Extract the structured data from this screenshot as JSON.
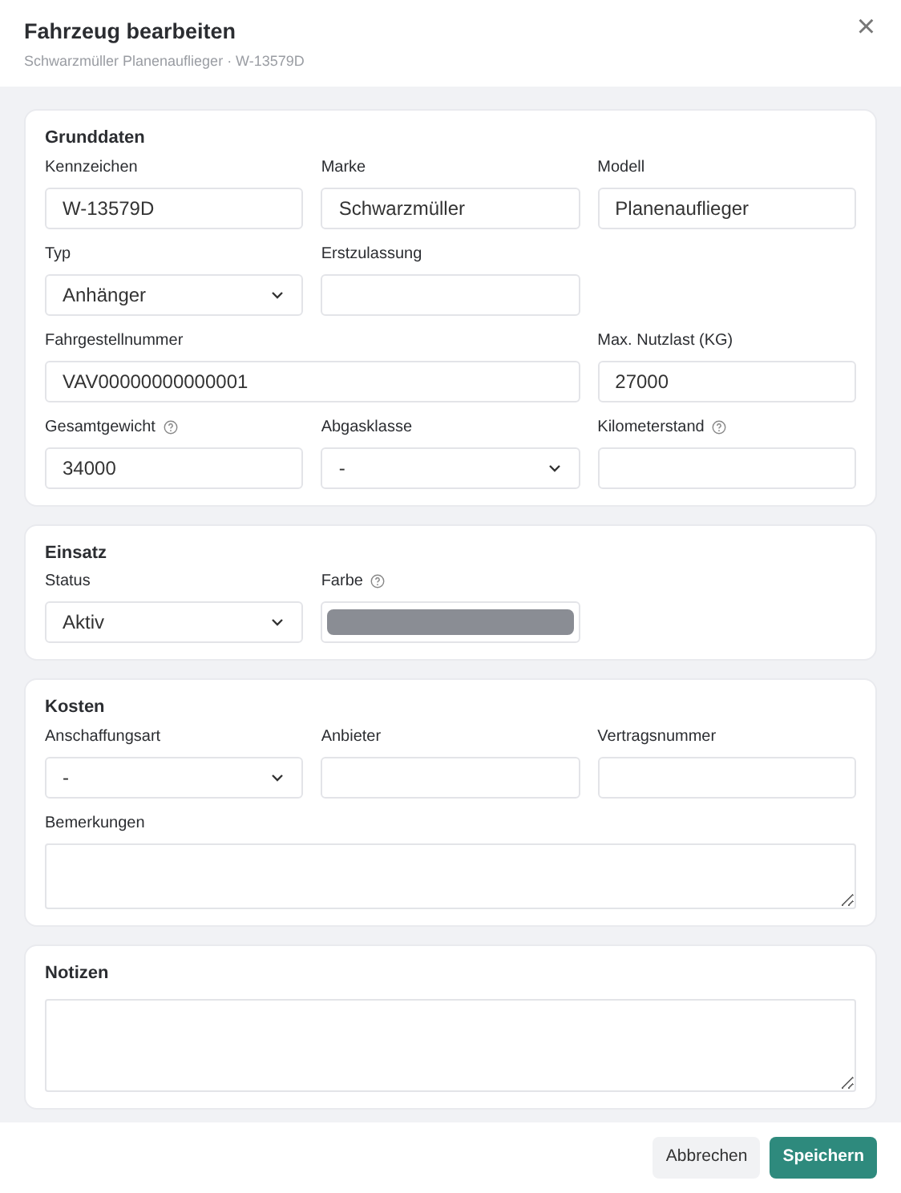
{
  "dialog": {
    "title": "Fahrzeug bearbeiten",
    "subtitle": "Schwarzmüller Planenauflieger · W-13579D",
    "close": "×"
  },
  "sections": [
    {
      "title": "Grunddaten",
      "rows": [
        [
          {
            "label": "Kennzeichen",
            "kind": "text",
            "value": "W-13579D"
          },
          {
            "label": "Marke",
            "kind": "text",
            "value": "Schwarzmüller"
          },
          {
            "label": "Modell",
            "kind": "text",
            "value": "Planenauflieger"
          }
        ],
        [
          {
            "label": "Typ",
            "kind": "select",
            "value": "Anhänger"
          },
          {
            "label": "Erstzulassung",
            "kind": "text"
          }
        ],
        [
          {
            "label": "Fahrgestellnummer",
            "kind": "text",
            "value": "VAV00000000000001"
          },
          "",
          {
            "label": "Max. Nutzlast (KG)",
            "kind": "text",
            "value": "27000"
          }
        ],
        [
          {
            "label": "Gesamtgewicht",
            "kind": "text",
            "value": "34000",
            "help": true
          },
          {
            "label": "Abgasklasse",
            "kind": "select",
            "value": "-"
          },
          {
            "label": "Kilometerstand",
            "kind": "text",
            "help": true
          }
        ]
      ]
    },
    {
      "title": "Einsatz",
      "rows": [
        [
          {
            "label": "Status",
            "kind": "select",
            "value": "Aktiv"
          },
          {
            "label": "Farbe",
            "kind": "color",
            "color": "#8a8d94",
            "help": true
          }
        ]
      ]
    },
    {
      "title": "Kosten",
      "rows": [
        [
          {
            "label": "Anschaffungsart",
            "kind": "select",
            "value": "-"
          },
          {
            "label": "Anbieter",
            "kind": "text"
          },
          {
            "label": "Vertragsnummer",
            "kind": "text"
          }
        ],
        [
          {
            "label": "Bemerkungen",
            "kind": "textarea"
          }
        ]
      ]
    },
    {
      "title": "Notizen",
      "rows": [
        [
          {
            "kind": "notes"
          }
        ]
      ]
    }
  ],
  "buttons": [
    {
      "label": "Abbrechen",
      "kind": "secondary"
    },
    {
      "label": "Speichern",
      "kind": "primary"
    }
  ]
}
